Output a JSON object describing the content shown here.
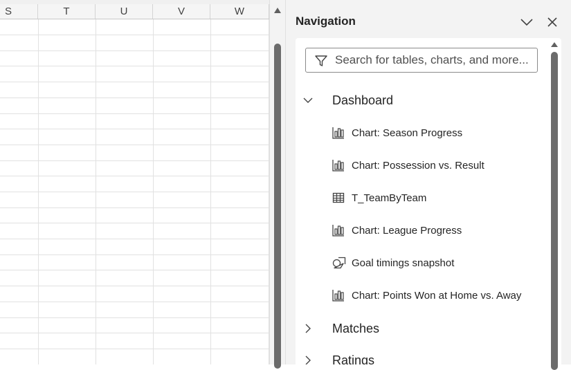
{
  "sheet": {
    "columns": [
      "S",
      "T",
      "U",
      "V",
      "W"
    ]
  },
  "navigation": {
    "title": "Navigation",
    "search_placeholder": "Search for tables, charts, and more...",
    "groups": [
      {
        "label": "Dashboard",
        "expanded": true,
        "items": [
          {
            "label": "Chart: Season Progress",
            "icon": "chart-icon"
          },
          {
            "label": "Chart: Possession vs. Result",
            "icon": "chart-icon"
          },
          {
            "label": "T_TeamByTeam",
            "icon": "table-icon"
          },
          {
            "label": "Chart: League Progress",
            "icon": "chart-icon"
          },
          {
            "label": "Goal timings snapshot",
            "icon": "shapes-icon"
          },
          {
            "label": "Chart: Points Won at Home vs. Away",
            "icon": "chart-icon"
          }
        ]
      },
      {
        "label": "Matches",
        "expanded": false
      },
      {
        "label": "Ratings",
        "expanded": false
      }
    ]
  }
}
